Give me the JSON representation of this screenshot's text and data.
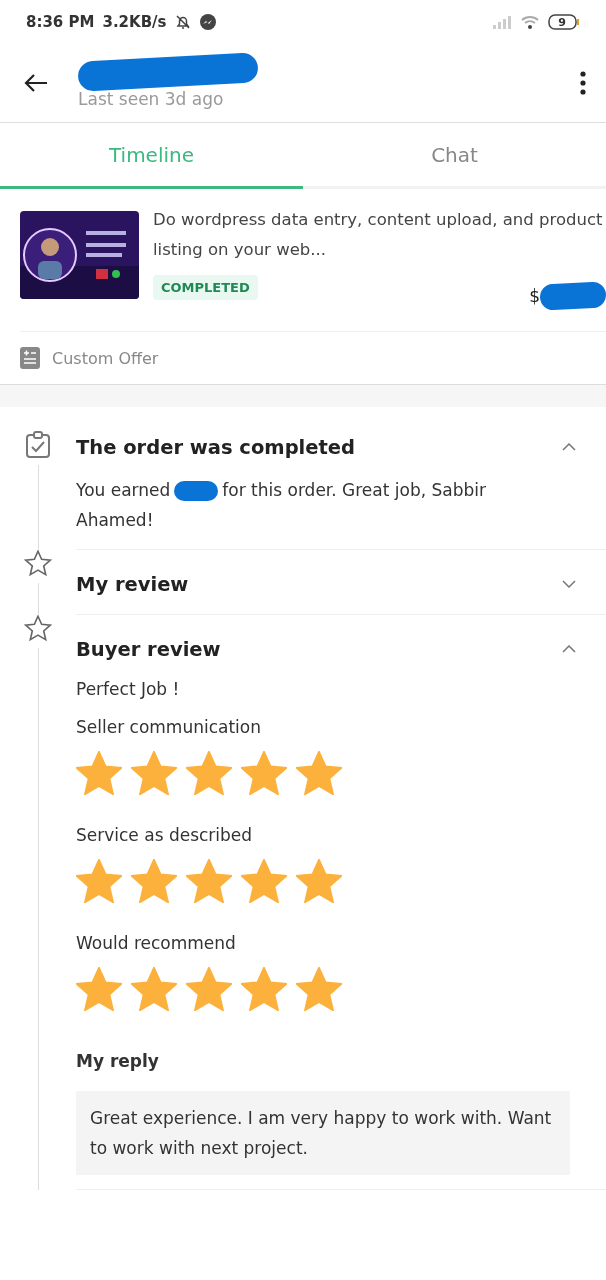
{
  "status_bar": {
    "time": "8:36 PM",
    "speed": "3.2KB/s",
    "battery": "9"
  },
  "header": {
    "last_seen": "Last seen 3d ago"
  },
  "tabs": [
    {
      "label": "Timeline",
      "selected": true
    },
    {
      "label": "Chat",
      "selected": false
    }
  ],
  "gig": {
    "title": "Do wordpress data entry, content upload, and product listing on your web...",
    "status": "COMPLETED",
    "price_symbol": "$"
  },
  "custom_offer": "Custom Offer",
  "timeline": [
    {
      "kind": "completed",
      "title": "The order was completed",
      "expanded": true,
      "earned_before": "You earned",
      "earned_after": "for this order. Great job, Sabbir Ahamed!"
    },
    {
      "kind": "review",
      "title": "My review",
      "expanded": false
    },
    {
      "kind": "review",
      "title": "Buyer review",
      "expanded": true,
      "comment": "Perfect Job !",
      "ratings": [
        {
          "label": "Seller communication",
          "stars": 5
        },
        {
          "label": "Service as described",
          "stars": 5
        },
        {
          "label": "Would recommend",
          "stars": 5
        }
      ],
      "reply_label": "My reply",
      "reply": "Great experience. I am very happy to work with. Want to work with next project."
    }
  ]
}
